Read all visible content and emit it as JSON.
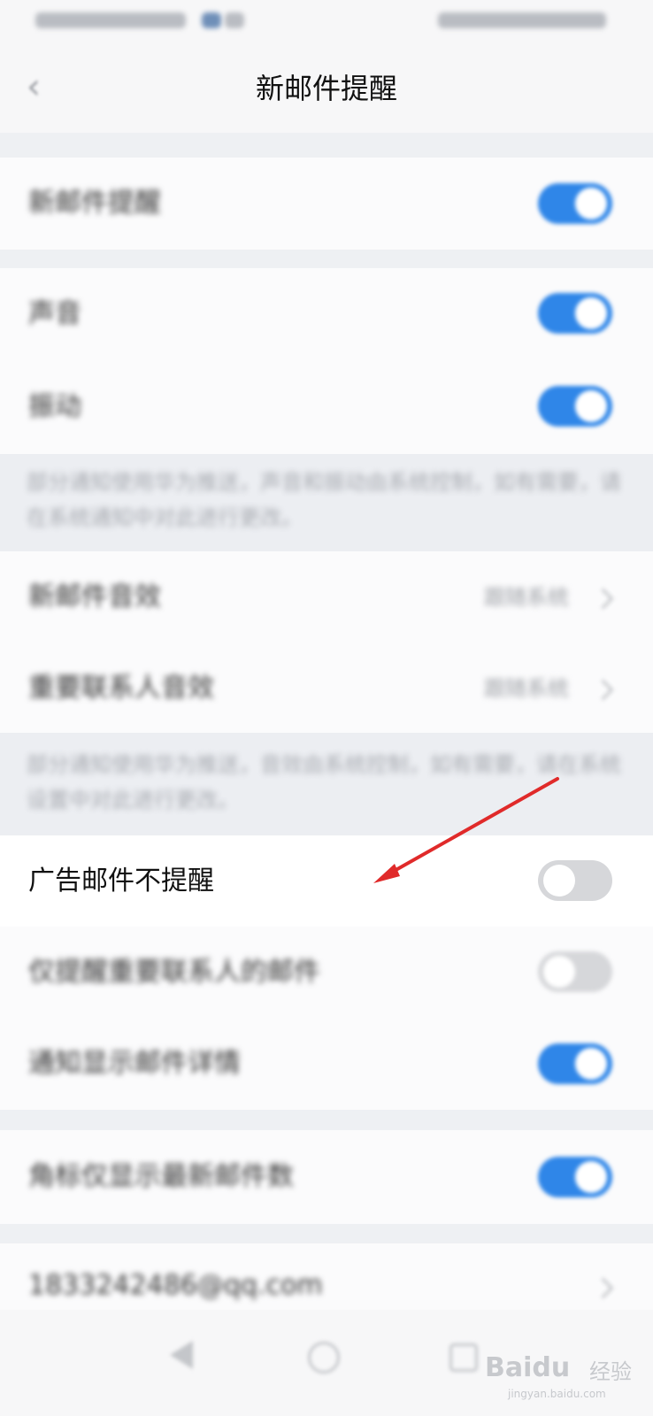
{
  "status_bar": {},
  "nav": {
    "title": "新邮件提醒"
  },
  "groups": {
    "master": {
      "label": "新邮件提醒",
      "toggle": "on"
    },
    "sound": {
      "label": "声音",
      "toggle": "on"
    },
    "vibrate": {
      "label": "振动",
      "toggle": "on"
    },
    "note1": "部分通知使用华为推送，声音和振动由系统控制，如有需要，请在系统通知中对此进行更改。",
    "new_mail_tone": {
      "label": "新邮件音效",
      "value": "跟随系统"
    },
    "vip_tone": {
      "label": "重要联系人音效",
      "value": "跟随系统"
    },
    "note2": "部分通知使用华为推送，音效由系统控制，如有需要，请在系统设置中对此进行更改。",
    "ad_no_remind": {
      "label": "广告邮件不提醒",
      "toggle": "off"
    },
    "vip_only": {
      "label": "仅提醒重要联系人的邮件",
      "toggle": "off"
    },
    "show_details": {
      "label": "通知显示邮件详情",
      "toggle": "on"
    },
    "badge_latest": {
      "label": "角标仅显示最新邮件数",
      "toggle": "on"
    },
    "account": {
      "label": "1833242486@qq.com"
    }
  },
  "watermark": {
    "logo": "Baidu",
    "text": "经验",
    "url": "jingyan.baidu.com"
  },
  "colors": {
    "accent": "#2f86e8",
    "arrow": "#e02a2a"
  }
}
